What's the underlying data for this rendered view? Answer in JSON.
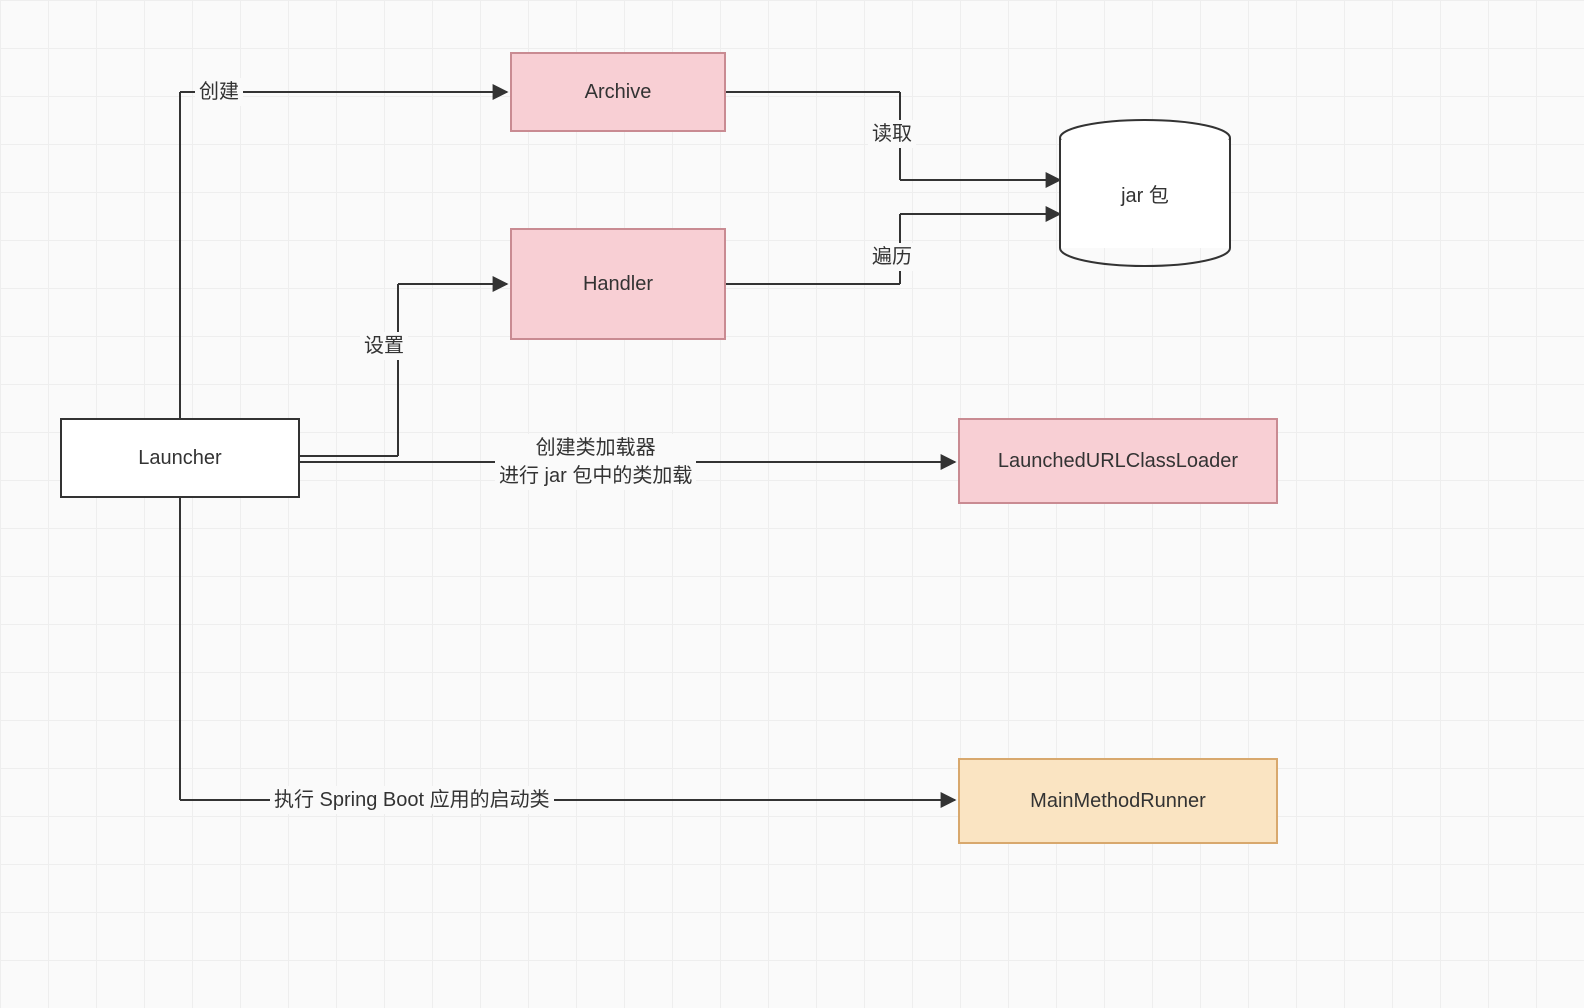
{
  "nodes": {
    "launcher": "Launcher",
    "archive": "Archive",
    "handler": "Handler",
    "classloader": "LaunchedURLClassLoader",
    "runner": "MainMethodRunner",
    "jar": "jar 包"
  },
  "labels": {
    "create": "创建",
    "set": "设置",
    "read": "读取",
    "traverse": "遍历",
    "classloader_line1": "创建类加载器",
    "classloader_line2": "进行 jar 包中的类加载",
    "runner_label": "执行 Spring Boot 应用的启动类"
  }
}
